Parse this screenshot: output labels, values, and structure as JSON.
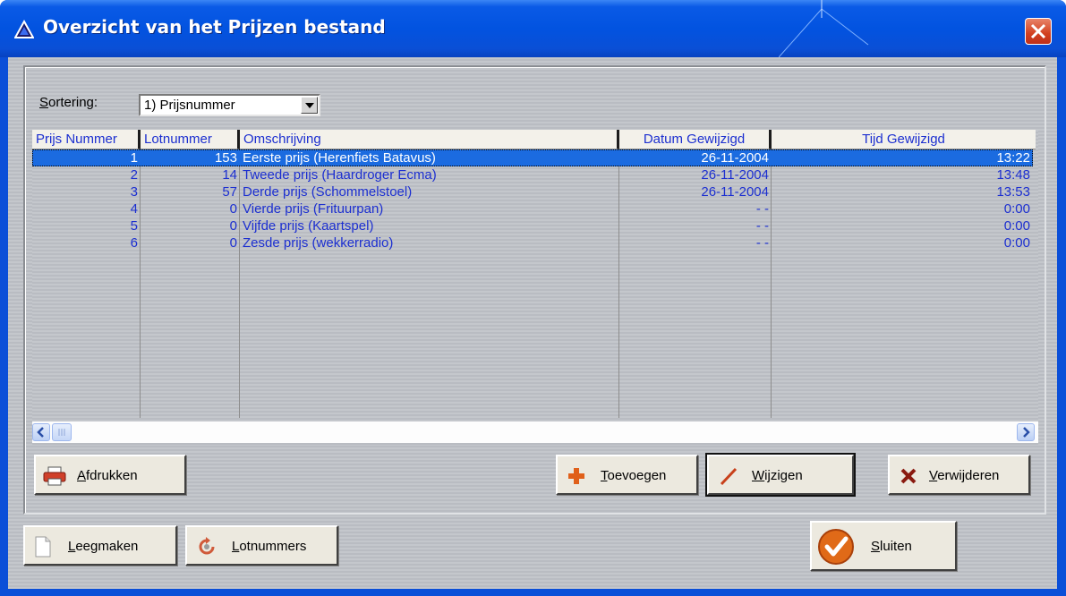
{
  "window": {
    "title": "Overzicht van het Prijzen bestand",
    "icon": "delta-triangle-icon",
    "close_icon": "close-x-icon"
  },
  "sort": {
    "label": "Sortering:",
    "value": "1) Prijsnummer"
  },
  "table": {
    "columns": [
      "Prijs Nummer",
      "Lotnummer",
      "Omschrijving",
      "Datum Gewijzigd",
      "Tijd Gewijzigd"
    ],
    "rows": [
      {
        "prijs": "1",
        "lot": "153",
        "omschrijving": "Eerste prijs (Herenfiets Batavus)",
        "datum": "26-11-2004",
        "tijd": "13:22"
      },
      {
        "prijs": "2",
        "lot": "14",
        "omschrijving": "Tweede prijs (Haardroger Ecma)",
        "datum": "26-11-2004",
        "tijd": "13:48"
      },
      {
        "prijs": "3",
        "lot": "57",
        "omschrijving": "Derde prijs (Schommelstoel)",
        "datum": "26-11-2004",
        "tijd": "13:53"
      },
      {
        "prijs": "4",
        "lot": "0",
        "omschrijving": "Vierde prijs (Frituurpan)",
        "datum": "- -",
        "tijd": "0:00"
      },
      {
        "prijs": "5",
        "lot": "0",
        "omschrijving": "Vijfde prijs (Kaartspel)",
        "datum": "- -",
        "tijd": "0:00"
      },
      {
        "prijs": "6",
        "lot": "0",
        "omschrijving": "Zesde prijs (wekkerradio)",
        "datum": "- -",
        "tijd": "0:00"
      }
    ],
    "selected_row": 1
  },
  "buttons": {
    "afdrukken": {
      "key": "A",
      "rest": "fdrukken",
      "icon": "printer-icon"
    },
    "toevoegen": {
      "key": "T",
      "rest": "oevoegen",
      "icon": "plus-icon"
    },
    "wijzigen": {
      "key": "W",
      "rest": "ijzigen",
      "icon": "pencil-icon"
    },
    "verwijderen": {
      "key": "V",
      "rest": "erwijderen",
      "icon": "delete-x-icon"
    },
    "leegmaken": {
      "key": "L",
      "rest": "eegmaken",
      "icon": "blank-page-icon"
    },
    "lotnummers": {
      "key": "L",
      "rest": "otnummers",
      "icon": "refresh-icon"
    },
    "sluiten": {
      "key": "S",
      "rest": "luiten",
      "icon": "checkmark-icon"
    }
  },
  "colors": {
    "titlebar": "#0253e0",
    "selection": "#1b6be0",
    "grid_text": "#1c2fd0"
  }
}
